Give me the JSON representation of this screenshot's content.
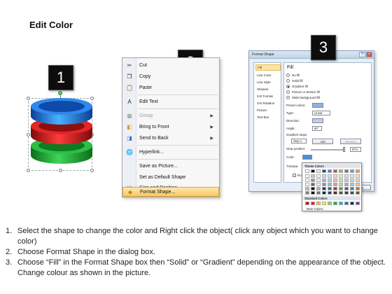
{
  "title": "Edit Color",
  "steps": {
    "s1": "1",
    "s2": "2",
    "s3": "3"
  },
  "colors": {
    "ring_blue": "#1e6fe0",
    "ring_red": "#d71a1a",
    "ring_green": "#19a72a",
    "menu_highlight": "#f9c968"
  },
  "context_menu": {
    "items": [
      {
        "icon": "scissors-icon",
        "label": "Cut"
      },
      {
        "icon": "copy-icon",
        "label": "Copy"
      },
      {
        "icon": "paste-icon",
        "label": "Paste"
      },
      {
        "icon": "edit-text-icon",
        "label": "Edit Text"
      },
      {
        "icon": "group-icon",
        "label": "Group"
      },
      {
        "icon": "bring-to-front-icon",
        "label": "Bring to Front"
      },
      {
        "icon": "send-to-back-icon",
        "label": "Send to Back"
      },
      {
        "icon": "hyperlink-icon",
        "label": "Hyperlink..."
      },
      {
        "icon": "",
        "label": "Save as Picture..."
      },
      {
        "icon": "",
        "label": "Set as Default Shape"
      },
      {
        "icon": "size-position-icon",
        "label": "Size and Position..."
      },
      {
        "icon": "format-shape-icon",
        "label": "Format Shape..."
      }
    ]
  },
  "dialog": {
    "title": "Format Shape",
    "nav": [
      "Fill",
      "Line Color",
      "Line Style",
      "Shadow",
      "3-D Format",
      "3-D Rotation",
      "Picture",
      "Text Box"
    ],
    "panel_title": "Fill",
    "fill_options": [
      "No fill",
      "Solid fill",
      "Gradient fill",
      "Picture or texture fill",
      "Slide background fill"
    ],
    "selected_fill": "Gradient fill",
    "preset_colors": "Preset colors:",
    "type_label": "Type:",
    "type_value": "Linear",
    "direction_label": "Direction:",
    "angle_label": "Angle:",
    "angle_value": "90°",
    "gradient_stops": "Gradient stops",
    "stop_value": "Stop 1",
    "add_btn": "Add",
    "remove_btn": "Remove",
    "stop_position_label": "Stop position:",
    "stop_position_value": "97%",
    "color_label": "Color:",
    "transparency_label": "Transpa",
    "rotate_label": "Rotate",
    "close_btn": "Close"
  },
  "palette": {
    "theme_colors": "Theme Colors",
    "standard_colors": "Standard Colors",
    "more_colors": "More Colors...",
    "theme_top": [
      "#ffffff",
      "#000000",
      "#eeece1",
      "#1f497d",
      "#4f81bd",
      "#c0504d",
      "#9bbb59",
      "#8064a2",
      "#4bacc6",
      "#f79646"
    ],
    "standard": [
      "#c00000",
      "#ff0000",
      "#ffc000",
      "#ffff00",
      "#92d050",
      "#00b050",
      "#00b0f0",
      "#0070c0",
      "#002060",
      "#7030a0"
    ]
  },
  "instructions": [
    {
      "n": "1.",
      "text": "Select the shape to change the color and Right click the object( click any object which you want to change color)"
    },
    {
      "n": "2.",
      "text": "Choose Format Shape in the dialog box."
    },
    {
      "n": "3.",
      "text": "Choose “Fill” in the Format Shape box then “Solid” or “Gradient” depending on the appearance of the object. Change colour as shown in the picture."
    }
  ]
}
